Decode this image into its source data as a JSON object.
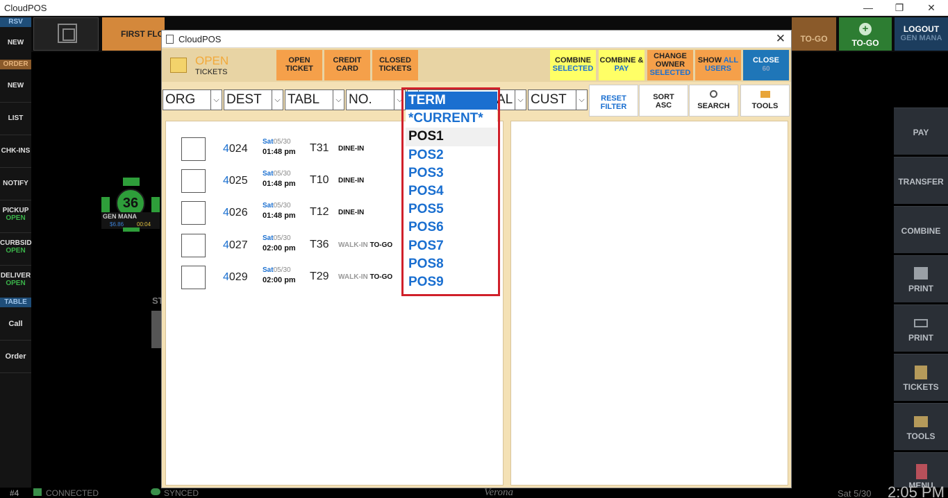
{
  "window": {
    "title": "CloudPOS",
    "controls": {
      "minimize": "—",
      "restore": "❐",
      "close": "✕"
    }
  },
  "left_nav": {
    "rsv_header": "RSV",
    "rsv_new": "NEW",
    "order_header": "ORDER",
    "order_new": "NEW",
    "list": "LIST",
    "chkins": "CHK-INS",
    "notify": "NOTIFY",
    "pickup": "PICKUP",
    "pickup_status": "OPEN",
    "curbside": "CURBSID",
    "curbside_status": "OPEN",
    "delivery": "DELIVER",
    "delivery_status": "OPEN",
    "table_header": "TABLE",
    "call": "Call",
    "order": "Order"
  },
  "top_bar": {
    "floor": "FIRST FLO",
    "togo_dim": "TO-GO",
    "togo": "TO-GO",
    "logout": "LOGOUT",
    "logout_user": "GEN MANA"
  },
  "right_nav": [
    "PAY",
    "TRANSFER",
    "COMBINE",
    "PRINT",
    "PRINT",
    "TICKETS",
    "TOOLS",
    "MENU"
  ],
  "floor_table": {
    "number": "36",
    "server": "GEN MANA",
    "amount": "$6.86",
    "time": "00:04",
    "partial_label": "ST"
  },
  "status_bar": {
    "terminal": "#4",
    "connected": "CONNECTED",
    "synced": "SYNCED",
    "location": "Verona",
    "date": "Sat 5/30",
    "time": "2:05 PM"
  },
  "dialog": {
    "title": "CloudPOS",
    "close": "✕",
    "header": {
      "open": "OPEN",
      "tickets": "TICKETS",
      "open_ticket": [
        "OPEN",
        "TICKET"
      ],
      "credit_card": [
        "CREDIT",
        "CARD"
      ],
      "closed_tickets": [
        "CLOSED",
        "TICKETS"
      ],
      "combine_selected": [
        "COMBINE",
        "SELECTED"
      ],
      "combine_pay": [
        "COMBINE &",
        "PAY"
      ],
      "change_owner": [
        "CHANGE",
        "OWNER",
        "SELECTED"
      ],
      "show_all": [
        "SHOW ",
        "ALL",
        "USERS"
      ],
      "close": [
        "CLOSE",
        "60"
      ]
    },
    "filters": {
      "org": "ORG",
      "dest": "DEST",
      "tabl": "TABL",
      "no": "NO.",
      "al_partial": "AL",
      "cust": "CUST",
      "reset_filter": [
        "RESET",
        "FILTER"
      ],
      "sort_asc": [
        "SORT",
        "ASC"
      ],
      "search": "SEARCH",
      "tools": "TOOLS"
    },
    "tickets": [
      {
        "num_prefix": "4",
        "num_rest": "024",
        "day": "Sat",
        "date": "05/30",
        "time": "01:48 pm",
        "table": "T31",
        "type_gray": "",
        "type": "DINE-IN"
      },
      {
        "num_prefix": "4",
        "num_rest": "025",
        "day": "Sat",
        "date": "05/30",
        "time": "01:48 pm",
        "table": "T10",
        "type_gray": "",
        "type": "DINE-IN"
      },
      {
        "num_prefix": "4",
        "num_rest": "026",
        "day": "Sat",
        "date": "05/30",
        "time": "01:48 pm",
        "table": "T12",
        "type_gray": "",
        "type": "DINE-IN"
      },
      {
        "num_prefix": "4",
        "num_rest": "027",
        "day": "Sat",
        "date": "05/30",
        "time": "02:00 pm",
        "table": "T36",
        "type_gray": "WALK-IN",
        "type": "TO-GO"
      },
      {
        "num_prefix": "4",
        "num_rest": "029",
        "day": "Sat",
        "date": "05/30",
        "time": "02:00 pm",
        "table": "T29",
        "type_gray": "WALK-IN",
        "type": "TO-GO"
      }
    ],
    "term_dropdown": [
      "TERM",
      "*CURRENT*",
      "POS1",
      "POS2",
      "POS3",
      "POS4",
      "POS5",
      "POS6",
      "POS7",
      "POS8",
      "POS9"
    ]
  },
  "colors": {
    "accent_blue": "#1a6fd0",
    "highlight_red": "#d0202a",
    "dialog_bg": "#f4e1b5",
    "orange_btn": "#f5a04a",
    "yellow_btn": "#ffff66",
    "close_btn": "#1f76b8"
  }
}
